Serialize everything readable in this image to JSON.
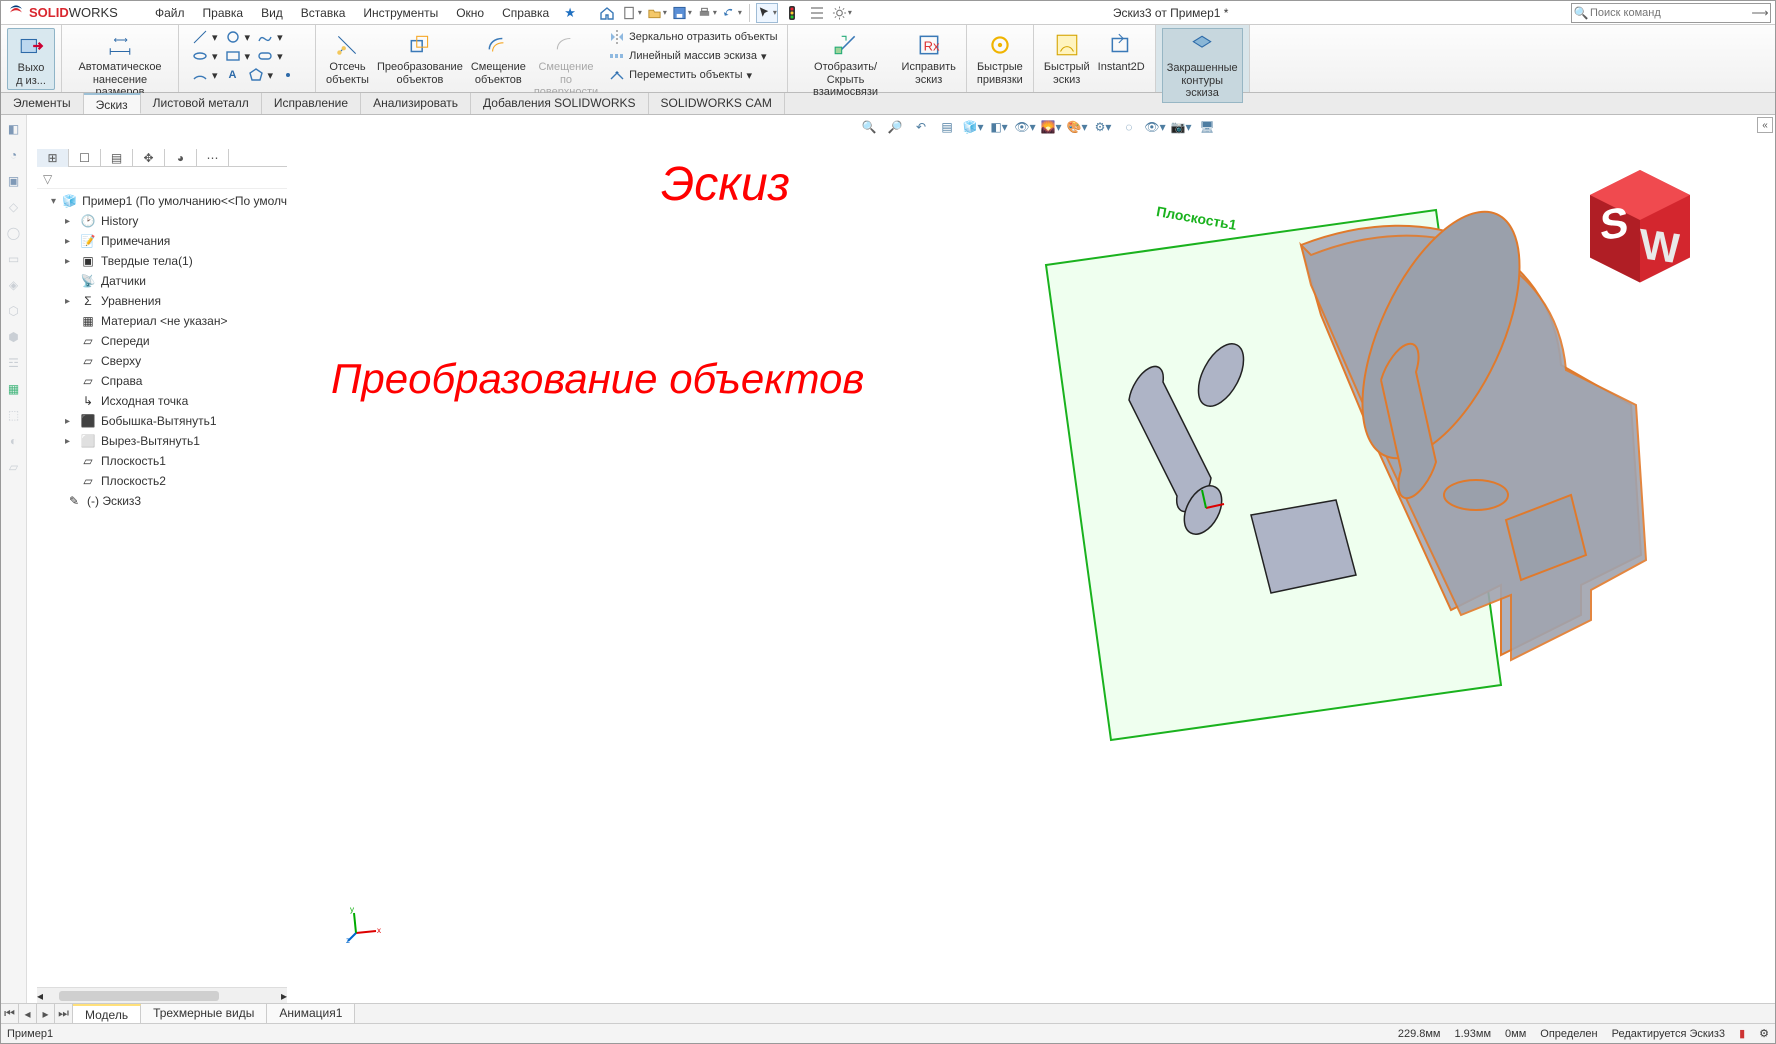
{
  "app": {
    "brand_solid": "SOLID",
    "brand_works": "WORKS",
    "doc_title": "Эскиз3 от Пример1 *"
  },
  "menu": {
    "file": "Файл",
    "edit": "Правка",
    "view": "Вид",
    "insert": "Вставка",
    "tools": "Инструменты",
    "window": "Окно",
    "help": "Справка"
  },
  "search": {
    "placeholder": "Поиск команд"
  },
  "ribbon": {
    "exit": "Выхо\nд из...",
    "smartdim": "Автоматическое\nнанесение размеров",
    "trim": "Отсечь\nобъекты",
    "convert": "Преобразование\nобъектов",
    "offset": "Смещение\nобъектов",
    "offset_surface": "Смещение\nпо\nповерхности",
    "mirror": "Зеркально отразить объекты",
    "linear_pattern": "Линейный массив эскиза",
    "move": "Переместить объекты",
    "showhide": "Отобразить/Скрыть\nвзаимосвязи",
    "repair": "Исправить\nэскиз",
    "quick_snaps": "Быстрые\nпривязки",
    "rapid_sketch": "Быстрый\nэскиз",
    "instant2d": "Instant2D",
    "shaded": "Закрашенные\nконтуры\nэскиза"
  },
  "tabs": {
    "features": "Элементы",
    "sketch": "Эскиз",
    "sheetmetal": "Листовой металл",
    "evaluate": "Исправление",
    "analyze": "Анализировать",
    "addins": "Добавления SOLIDWORKS",
    "cam": "SOLIDWORKS CAM"
  },
  "tree": {
    "root": "Пример1  (По умолчанию<<По умолч",
    "history": "History",
    "annotations": "Примечания",
    "solid_bodies": "Твердые тела(1)",
    "sensors": "Датчики",
    "equations": "Уравнения",
    "material": "Материал <не указан>",
    "front": "Спереди",
    "top": "Сверху",
    "right": "Справа",
    "origin": "Исходная точка",
    "boss": "Бобышка-Вытянуть1",
    "cut": "Вырез-Вытянуть1",
    "plane1": "Плоскость1",
    "plane2": "Плоскость2",
    "sketch3": "(-) Эскиз3"
  },
  "overlay": {
    "title": "Эскиз",
    "subtitle": "Преобразование объектов",
    "plane_label": "Плоскость1"
  },
  "bottom_tabs": {
    "model": "Модель",
    "views3d": "Трехмерные виды",
    "anim": "Анимация1"
  },
  "status": {
    "doc": "Пример1",
    "coord": "229.8мм",
    "v2": "1.93мм",
    "v3": "0мм",
    "defined": "Определен",
    "editing": "Редактируется Эскиз3"
  }
}
